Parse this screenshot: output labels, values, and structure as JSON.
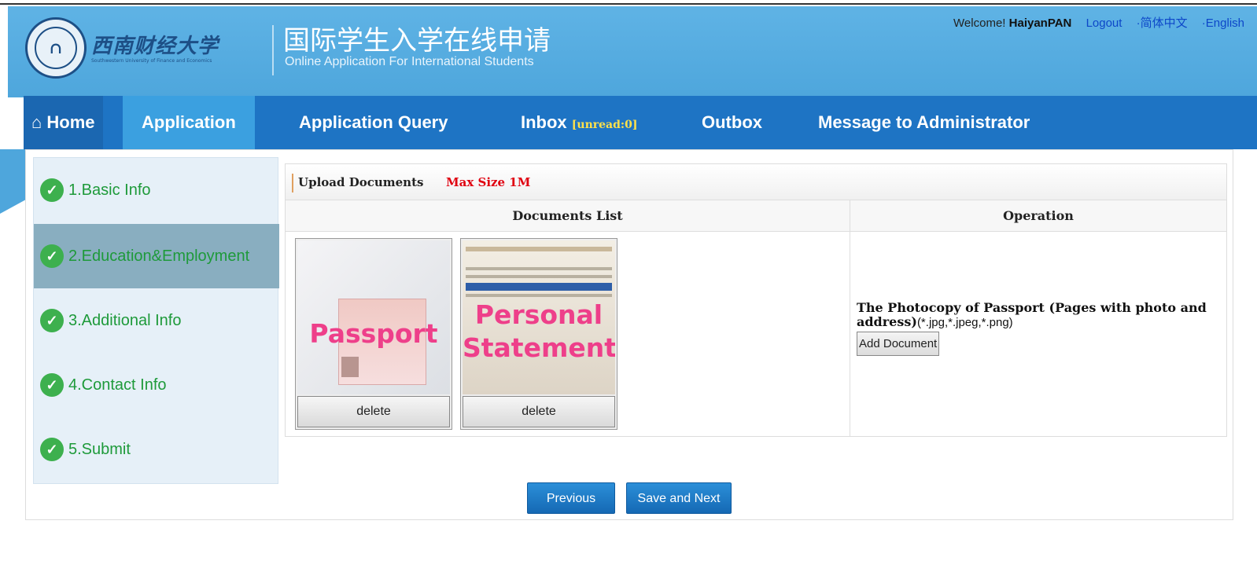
{
  "header": {
    "logo_name": "西南财经大学",
    "logo_sub": "Southwestern University of Finance and Economics",
    "title_cn": "国际学生入学在线申请",
    "title_en": "Online Application For International Students",
    "welcome": "Welcome!",
    "username": "HaiyanPAN",
    "logout": "Logout",
    "lang_cn": "·简体中文",
    "lang_en": "·English"
  },
  "nav": {
    "home": "Home",
    "application": "Application",
    "query": "Application Query",
    "inbox": "Inbox",
    "inbox_unread": "[unread:0]",
    "outbox": "Outbox",
    "message": "Message to Administrator"
  },
  "steps": [
    {
      "label": "1.Basic Info"
    },
    {
      "label": "2.Education&Employment"
    },
    {
      "label": "3.Additional Info"
    },
    {
      "label": "4.Contact Info"
    },
    {
      "label": "5.Submit"
    }
  ],
  "upload": {
    "title": "Upload Documents",
    "max_size": "Max Size 1M",
    "col_docs": "Documents List",
    "col_op": "Operation",
    "documents": [
      {
        "label": "Passport",
        "delete": "delete"
      },
      {
        "label": "Personal Statement",
        "delete": "delete"
      }
    ],
    "op_title": "The Photocopy of Passport (Pages with photo and address)",
    "op_ext": "(*.jpg,*.jpeg,*.png)",
    "add_document": "Add Document"
  },
  "buttons": {
    "previous": "Previous",
    "save_next": "Save and Next"
  },
  "colors": {
    "header_blue": "#4ea6dc",
    "nav_blue": "#1e74c4",
    "step_green": "#1e9a3a",
    "max_red": "#e00010",
    "label_pink": "#ee3f8a"
  }
}
